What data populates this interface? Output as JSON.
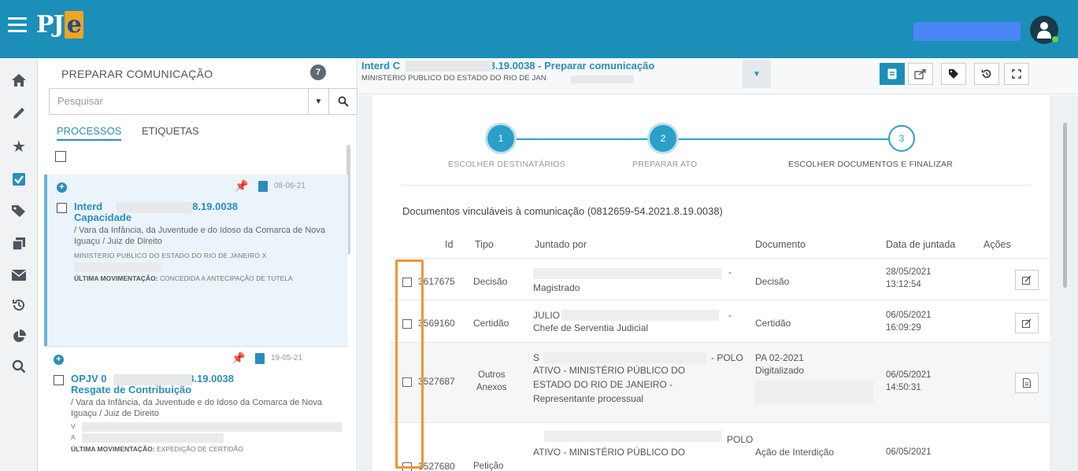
{
  "app": {
    "logo_text": "PJ",
    "logo_accent": "e",
    "brand_color": "#1b8fb8",
    "accent_color": "#f0943a"
  },
  "sidebar_icons": [
    "home-icon",
    "pencil-icon",
    "star-icon",
    "checkbox-icon",
    "tags-icon",
    "copy-icon",
    "mail-icon",
    "history-icon",
    "pie-chart-icon",
    "search-icon"
  ],
  "list": {
    "title": "PREPARAR COMUNICAÇÃO",
    "count": "7",
    "search_placeholder": "Pesquisar",
    "tabs": [
      {
        "label": "PROCESSOS"
      },
      {
        "label": "ETIQUETAS"
      }
    ],
    "cards": [
      {
        "date": "08-06-21",
        "number_prefix": "Interd",
        "number_suffix": "21.8.19.0038",
        "subject": "Capacidade",
        "vara": "/ Vara da Infância, da Juventude e do Idoso da Comarca de Nova Iguaçu / Juiz de Direito",
        "parties": "MINISTERIO PUBLICO DO ESTADO DO RIO DE JANEIRO X",
        "mov_label": "ÚLTIMA MOVIMENTAÇÃO:",
        "mov_text": "CONCEDIDA A ANTECIPAÇÃO DE TUTELA"
      },
      {
        "date": "19-05-21",
        "number_prefix": "OPJV 0",
        "number_suffix": ".8.19.0038",
        "subject": "Resgate de Contribuição",
        "vara": "/ Vara da Infância, da Juventude e do Idoso da Comarca de Nova Iguaçu / Juiz de Direito",
        "parties": "V",
        "parties2": "A",
        "mov_label": "ÚLTIMA MOVIMENTAÇÃO:",
        "mov_text": "EXPEDIÇÃO DE CERTIDÃO"
      }
    ]
  },
  "header": {
    "title_prefix": "Interd C",
    "title_suffix": ".8.19.0038 - Preparar comunicação",
    "subtitle": "MINISTERIO PUBLICO DO ESTADO DO RIO DE JAN"
  },
  "steps": [
    {
      "number": "1",
      "label": "ESCOLHER DESTINATÁRIOS"
    },
    {
      "number": "2",
      "label": "PREPARAR ATO"
    },
    {
      "number": "3",
      "label": "ESCOLHER DOCUMENTOS E FINALIZAR"
    }
  ],
  "docs": {
    "title": "Documentos vinculáveis à comunicação (0812659-54.2021.8.19.0038)",
    "columns": [
      "Id",
      "Tipo",
      "Juntado por",
      "Documento",
      "Data de juntada",
      "Ações"
    ],
    "rows": [
      {
        "id": "3617675",
        "tipo": "Decisão",
        "juntado_1": "-",
        "juntado_2": "Magistrado",
        "documento": "Decisão",
        "data": "28/05/2021",
        "hora": "13:12:54",
        "acao_icon": "edit-icon"
      },
      {
        "id": "3569160",
        "tipo": "Certidão",
        "juntado_1": "JULIO",
        "juntado_dash": "-",
        "juntado_2": "Chefe de Serventia Judicial",
        "documento": "Certidão",
        "data": "06/05/2021",
        "hora": "16:09:29",
        "acao_icon": "edit-icon"
      },
      {
        "id": "3527687",
        "tipo_1": "Outros",
        "tipo_2": "Anexos",
        "juntado_1": "S",
        "juntado_1b": "- POLO",
        "juntado_2": "ATIVO - MINISTÉRIO PÚBLICO DO",
        "juntado_3": "ESTADO DO RIO DE JANEIRO -",
        "juntado_4": "Representante processual",
        "documento_1": "PA 02-2021",
        "documento_2": "Digitalizado",
        "data": "06/05/2021",
        "hora": "14:50:31",
        "acao_icon": "document-icon"
      },
      {
        "id": "3527680",
        "tipo": "Petição",
        "juntado_1b": "POLO",
        "juntado_2": "ATIVO - MINISTÉRIO PÚBLICO DO",
        "documento": "Ação de Interdição",
        "data": "06/05/2021"
      }
    ]
  }
}
